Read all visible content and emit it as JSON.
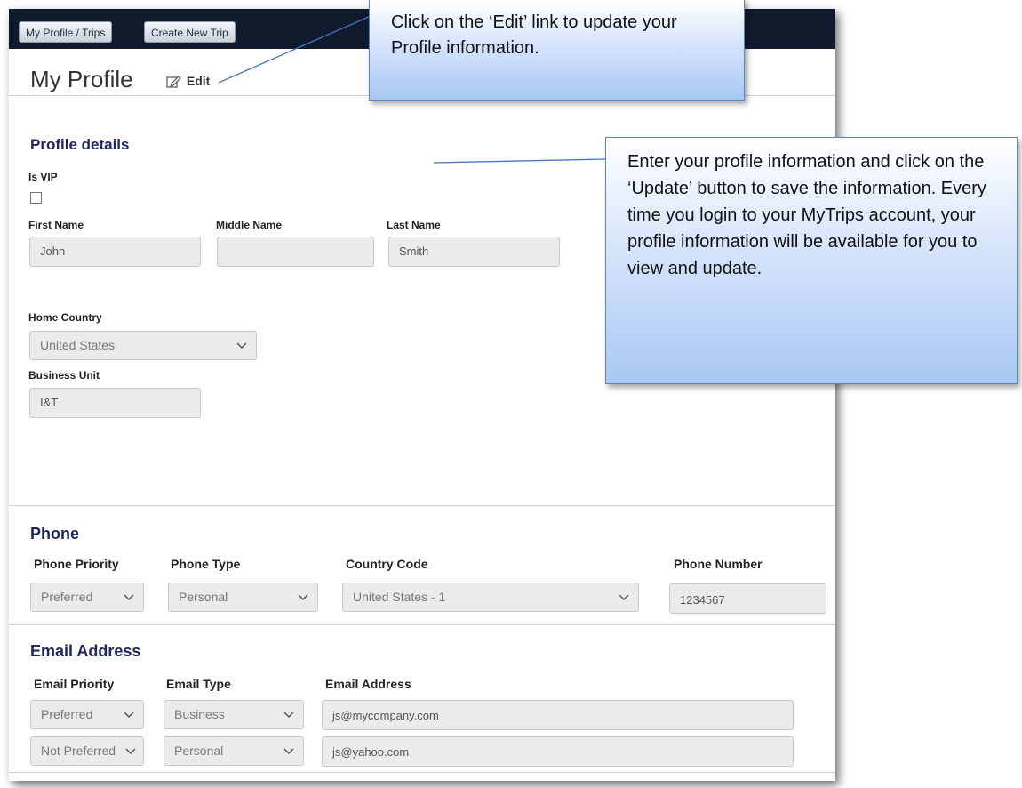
{
  "nav": {
    "profile_trips": "My Profile / Trips",
    "create_trip": "Create New Trip"
  },
  "page": {
    "title": "My Profile",
    "edit_label": "Edit"
  },
  "profile": {
    "heading": "Profile details",
    "vip_label": "Is VIP",
    "vip_checked": false,
    "first_name_label": "First Name",
    "middle_name_label": "Middle Name",
    "last_name_label": "Last Name",
    "first_name": "John",
    "middle_name": "",
    "last_name": "Smith",
    "home_country_label": "Home Country",
    "home_country": "United States",
    "business_unit_label": "Business Unit",
    "business_unit": "I&T"
  },
  "phone": {
    "heading": "Phone",
    "priority_label": "Phone Priority",
    "type_label": "Phone Type",
    "country_code_label": "Country Code",
    "number_label": "Phone Number",
    "priority": "Preferred",
    "type": "Personal",
    "country_code": "United States - 1",
    "number": "1234567"
  },
  "email": {
    "heading": "Email Address",
    "priority_label": "Email Priority",
    "type_label": "Email Type",
    "address_label": "Email Address",
    "rows": [
      {
        "priority": "Preferred",
        "type": "Business",
        "address": "js@mycompany.com"
      },
      {
        "priority": "Not Preferred",
        "type": "Personal",
        "address": "js@yahoo.com"
      }
    ]
  },
  "callouts": {
    "edit": "Click on the ‘Edit’ link to update your Profile information.",
    "update": "Enter your profile information and click on the ‘Update’ button to save the information. Every time you login to your MyTrips account, your profile information will be available for you to view and update."
  },
  "colors": {
    "topbar": "#0f1b2d",
    "section_heading": "#1e2760",
    "callout_border": "#5b83c6"
  }
}
